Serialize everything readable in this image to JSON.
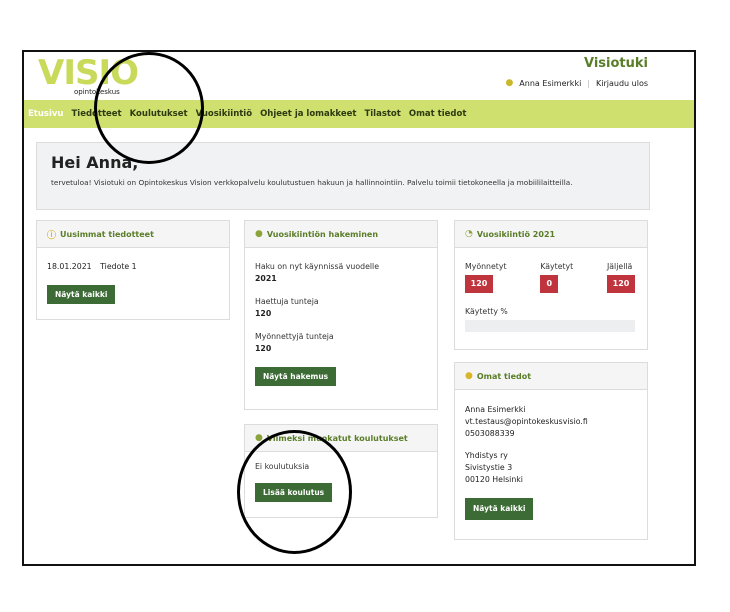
{
  "header": {
    "logo_text": "VISIO",
    "logo_subtext": "opintokeskus",
    "site_title": "Visiotuki",
    "user_name": "Anna Esimerkki",
    "logout_label": "Kirjaudu ulos"
  },
  "nav": {
    "items": [
      "Etusivu",
      "Tiedotteet",
      "Koulutukset",
      "Vuosikiintiö",
      "Ohjeet ja lomakkeet",
      "Tilastot",
      "Omat tiedot"
    ]
  },
  "welcome": {
    "heading": "Hei Anna,",
    "text": "tervetuloa! Visiotuki on Opintokeskus Vision verkkopalvelu koulutustuen hakuun ja hallinnointiin. Palvelu toimii tietokoneella ja mobiililaitteilla."
  },
  "news": {
    "title": "Uusimmat tiedotteet",
    "date": "18.01.2021",
    "item": "Tiedote 1",
    "button": "Näytä kaikki"
  },
  "application": {
    "title": "Vuosikiintiön hakeminen",
    "open_label": "Haku on nyt käynnissä vuodelle",
    "open_value": "2021",
    "applied_label": "Haettuja tunteja",
    "applied_value": "120",
    "granted_label": "Myönnettyjä tunteja",
    "granted_value": "120",
    "button": "Näytä hakemus"
  },
  "quota": {
    "title": "Vuosikiintiö 2021",
    "granted_label": "Myönnetyt",
    "granted_value": "120",
    "used_label": "Käytetyt",
    "used_value": "0",
    "left_label": "Jäljellä",
    "left_value": "120",
    "used_pct_label": "Käytetty %",
    "used_pct": 0
  },
  "recent": {
    "title": "Viimeksi muokatut koulutukset",
    "empty": "Ei koulutuksia",
    "button": "Lisää koulutus"
  },
  "profile": {
    "title": "Omat tiedot",
    "name": "Anna Esimerkki",
    "email": "vt.testaus@opintokeskusvisio.fi",
    "phone": "0503088339",
    "org": "Yhdistys ry",
    "street": "Sivistystie 3",
    "city": "00120 Helsinki",
    "button": "Näytä kaikki"
  }
}
